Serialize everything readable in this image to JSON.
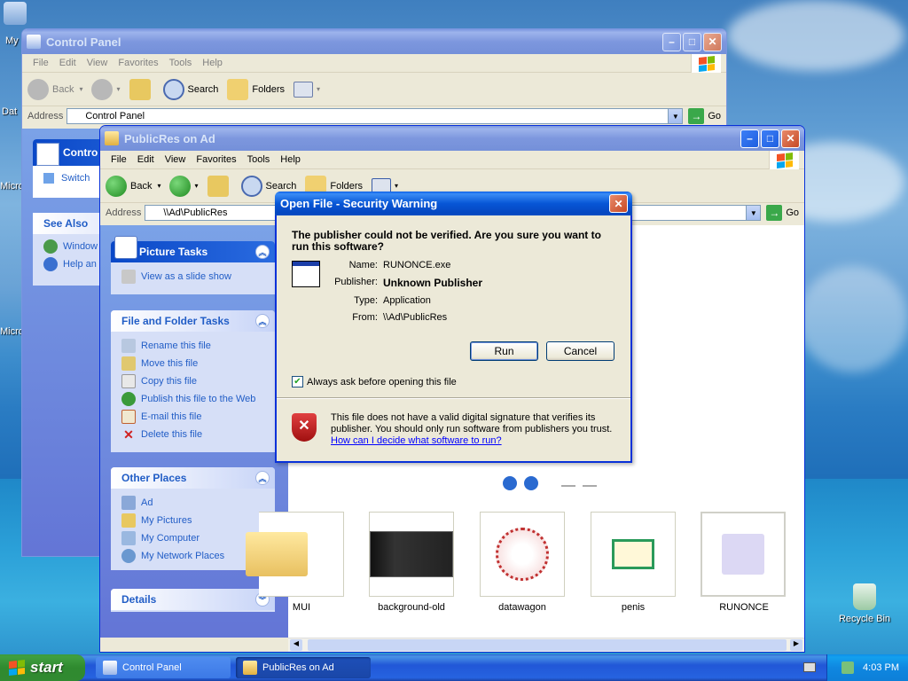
{
  "desktop": {
    "icons": [
      {
        "label": "My"
      },
      {
        "label": "Dat"
      },
      {
        "label": "Micro"
      },
      {
        "label": "Micro"
      },
      {
        "label": "Recycle Bin"
      }
    ]
  },
  "control_panel": {
    "title": "Control Panel",
    "menu": [
      "File",
      "Edit",
      "View",
      "Favorites",
      "Tools",
      "Help"
    ],
    "toolbar": {
      "back": "Back",
      "search": "Search",
      "folders": "Folders"
    },
    "address_label": "Address",
    "address_value": "Control Panel",
    "go": "Go",
    "side": {
      "control": "Contro",
      "switch": "Switch",
      "see_also": "See Also",
      "windows": "Window",
      "help": "Help an"
    }
  },
  "publicres": {
    "title": "PublicRes on Ad",
    "menu": [
      "File",
      "Edit",
      "View",
      "Favorites",
      "Tools",
      "Help"
    ],
    "toolbar": {
      "back": "Back",
      "search": "Search",
      "folders": "Folders"
    },
    "address_label": "Address",
    "address_value": "\\\\Ad\\PublicRes",
    "go": "Go",
    "picture_tasks": {
      "title": "Picture Tasks",
      "items": [
        "View as a slide show"
      ]
    },
    "file_tasks": {
      "title": "File and Folder Tasks",
      "items": [
        "Rename this file",
        "Move this file",
        "Copy this file",
        "Publish this file to the Web",
        "E-mail this file",
        "Delete this file"
      ]
    },
    "other_places": {
      "title": "Other Places",
      "items": [
        "Ad",
        "My Pictures",
        "My Computer",
        "My Network Places"
      ]
    },
    "details": {
      "title": "Details"
    },
    "thumbnails": [
      "MUI",
      "background-old",
      "datawagon",
      "penis",
      "RUNONCE"
    ]
  },
  "dialog": {
    "title": "Open File - Security Warning",
    "question": "The publisher could not be verified.  Are you sure you want to run this software?",
    "fields": [
      {
        "key": "Name:",
        "value": "RUNONCE.exe"
      },
      {
        "key": "Publisher:",
        "value": "Unknown Publisher"
      },
      {
        "key": "Type:",
        "value": "Application"
      },
      {
        "key": "From:",
        "value": "\\\\Ad\\PublicRes"
      }
    ],
    "run": "Run",
    "cancel": "Cancel",
    "checkbox": "Always ask before opening this file",
    "warning": "This file does not have a valid digital signature that verifies its publisher.  You should only run software from publishers you trust.",
    "link": "How can I decide what software to run?"
  },
  "taskbar": {
    "start": "start",
    "items": [
      "Control Panel",
      "PublicRes on Ad"
    ],
    "clock": "4:03 PM"
  }
}
